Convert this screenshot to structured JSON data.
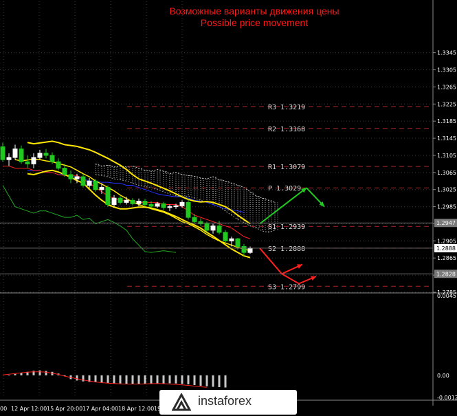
{
  "title_ru": "Возможные варианты движения цены",
  "title_en": "Possible price movement",
  "watermark": "instaforex",
  "colors": {
    "bg": "#000000",
    "grid": "#3a3a3a",
    "axis_text": "#ffffff",
    "level_line": "#b22222",
    "level_text": "#d8d8d8",
    "bull": "#ffffff",
    "bear": "#20c820",
    "bollinger": "#ffe600",
    "kijun": "#ff2020",
    "tenkan": "#2030ff",
    "chikou": "#22aa22",
    "arrow_up": "#22cc22",
    "arrow_down": "#ff2020",
    "title": "#ff1a1a",
    "macd_hist": "#c8c8c8",
    "signal": "#ff2020",
    "badge_bg": "#7a7a7a"
  },
  "chart_data": {
    "type": "candlestick",
    "ylim": [
      1.2785,
      1.3465
    ],
    "y_ticks": [
      "1.3345",
      "1.3305",
      "1.3265",
      "1.3225",
      "1.3185",
      "1.3145",
      "1.3105",
      "1.3065",
      "1.3025",
      "1.2985",
      "1.2945",
      "1.2905",
      "1.2865",
      "1.2825",
      "1.2785"
    ],
    "x_ticks": [
      "00",
      "12 Apr 12:00",
      "15 Apr 20:00",
      "17 Apr 04:00",
      "18 Apr 12:00",
      "19 Ap"
    ],
    "levels": [
      {
        "label": "R3",
        "value": "1.3219"
      },
      {
        "label": "R2",
        "value": "1.3168"
      },
      {
        "label": "R1",
        "value": "1.3079"
      },
      {
        "label": "P",
        "value": "1.3029"
      },
      {
        "label": "S1",
        "value": "1.2939"
      },
      {
        "label": "S2",
        "value": "1.2888"
      },
      {
        "label": "S3",
        "value": "1.2799"
      }
    ],
    "price_badges": [
      {
        "value": "1.2947",
        "highlight": true
      },
      {
        "value": "1.2888",
        "highlight": false
      },
      {
        "value": "1.2828",
        "highlight": true
      }
    ],
    "candles": [
      [
        1.3125,
        1.3135,
        1.309,
        1.3095
      ],
      [
        1.3095,
        1.311,
        1.308,
        1.31
      ],
      [
        1.31,
        1.313,
        1.3095,
        1.312
      ],
      [
        1.312,
        1.3128,
        1.3085,
        1.309
      ],
      [
        1.309,
        1.3105,
        1.3075,
        1.3085
      ],
      [
        1.3085,
        1.311,
        1.3075,
        1.31
      ],
      [
        1.31,
        1.3118,
        1.3095,
        1.311
      ],
      [
        1.311,
        1.312,
        1.3098,
        1.3105
      ],
      [
        1.3105,
        1.3112,
        1.3085,
        1.309
      ],
      [
        1.309,
        1.3098,
        1.307,
        1.3075
      ],
      [
        1.3075,
        1.3085,
        1.3055,
        1.306
      ],
      [
        1.306,
        1.307,
        1.304,
        1.305
      ],
      [
        1.305,
        1.3062,
        1.304,
        1.3055
      ],
      [
        1.3055,
        1.3062,
        1.303,
        1.3035
      ],
      [
        1.3035,
        1.3052,
        1.3028,
        1.3045
      ],
      [
        1.3045,
        1.305,
        1.302,
        1.3025
      ],
      [
        1.3025,
        1.304,
        1.3015,
        1.303
      ],
      [
        1.303,
        1.3035,
        1.2985,
        1.299
      ],
      [
        1.299,
        1.3012,
        1.2984,
        1.3005
      ],
      [
        1.3005,
        1.301,
        1.299,
        1.2995
      ],
      [
        1.2995,
        1.3008,
        1.299,
        1.3
      ],
      [
        1.3,
        1.3005,
        1.2988,
        1.2992
      ],
      [
        1.2992,
        1.3004,
        1.2986,
        1.2998
      ],
      [
        1.2998,
        1.3003,
        1.2985,
        1.299
      ],
      [
        1.299,
        1.2998,
        1.2982,
        1.2986
      ],
      [
        1.2986,
        1.2996,
        1.2982,
        1.2992
      ],
      [
        1.2992,
        1.2996,
        1.2978,
        1.2983
      ],
      [
        1.2983,
        1.299,
        1.2975,
        1.2985
      ],
      [
        1.2985,
        1.2992,
        1.298,
        1.2987
      ],
      [
        1.2987,
        1.3,
        1.2983,
        1.2995
      ],
      [
        1.2995,
        1.3002,
        1.2955,
        1.296
      ],
      [
        1.296,
        1.2968,
        1.2945,
        1.295
      ],
      [
        1.295,
        1.2958,
        1.294,
        1.2945
      ],
      [
        1.2945,
        1.295,
        1.2925,
        1.293
      ],
      [
        1.293,
        1.2945,
        1.2922,
        1.294
      ],
      [
        1.294,
        1.2952,
        1.292,
        1.2925
      ],
      [
        1.2925,
        1.293,
        1.29,
        1.2905
      ],
      [
        1.2905,
        1.2915,
        1.2892,
        1.291
      ],
      [
        1.291,
        1.2912,
        1.2885,
        1.2892
      ],
      [
        1.2892,
        1.2898,
        1.287,
        1.2878
      ],
      [
        1.2878,
        1.2892,
        1.2875,
        1.2888
      ]
    ],
    "bollinger_upper": [
      1.3135,
      1.3132,
      1.3134,
      1.3136,
      1.3138,
      1.3135,
      1.313,
      1.3128,
      1.3126,
      1.3122,
      1.3118,
      1.3112,
      1.3105,
      1.3098,
      1.309,
      1.3082,
      1.3072,
      1.306,
      1.305,
      1.3045,
      1.304,
      1.3034,
      1.3028,
      1.3022,
      1.3015,
      1.3008,
      1.3002,
      1.2998,
      1.2996,
      1.2997,
      1.2995,
      1.299,
      1.2985,
      1.2976,
      1.2965,
      1.2955,
      1.2945
    ],
    "bollinger_middle": [
      1.3095,
      1.3092,
      1.3094,
      1.3096,
      1.3095,
      1.3092,
      1.309,
      1.3086,
      1.3082,
      1.3078,
      1.307,
      1.3062,
      1.3055,
      1.3045,
      1.3038,
      1.303,
      1.3022,
      1.3012,
      1.3004,
      1.2996,
      1.299,
      1.2985,
      1.298,
      1.2976,
      1.2972,
      1.2966,
      1.2958,
      1.295,
      1.2945,
      1.2938,
      1.293,
      1.292,
      1.2912,
      1.2905,
      1.29,
      1.2895,
      1.289,
      1.2886,
      1.2882
    ],
    "bollinger_lower": [
      1.3062,
      1.306,
      1.3064,
      1.3068,
      1.307,
      1.3066,
      1.306,
      1.3054,
      1.3046,
      1.304,
      1.3026,
      1.3012,
      1.3,
      1.299,
      1.2984,
      1.298,
      1.298,
      1.2982,
      1.2984,
      1.2984,
      1.2982,
      1.2978,
      1.2974,
      1.2968,
      1.2962,
      1.2955,
      1.2948,
      1.2942,
      1.2935,
      1.2925,
      1.2916,
      1.2906,
      1.2896,
      1.2886,
      1.2878,
      1.287,
      1.2866
    ],
    "kijun": [
      1.308,
      1.308,
      1.3075,
      1.3075,
      1.3075,
      1.307,
      1.307,
      1.3065,
      1.3065,
      1.306,
      1.3058,
      1.3058,
      1.3058,
      1.305,
      1.304,
      1.303,
      1.302,
      1.301,
      1.3005,
      1.3,
      1.3,
      1.2998,
      1.2995,
      1.2995,
      1.2995,
      1.2995,
      1.299,
      1.299,
      1.299,
      1.2985,
      1.2975,
      1.2965,
      1.296,
      1.2955,
      1.295,
      1.2945,
      1.294,
      1.2935,
      1.2925,
      1.2915,
      1.291
    ],
    "tenkan": [
      1.307,
      1.307,
      1.307,
      1.3065,
      1.3065,
      1.306,
      1.306,
      1.3055,
      1.3055,
      1.305,
      1.3045,
      1.3045,
      1.3042,
      1.3042,
      1.304,
      1.304,
      1.3035,
      1.3035,
      1.303,
      1.3025,
      1.302,
      1.3015,
      1.3012,
      1.301,
      1.3008,
      1.3008,
      1.3005,
      1.3,
      1.2998,
      1.2995,
      1.299,
      1.2985,
      1.298,
      1.2978,
      1.2975,
      1.2972
    ],
    "chikou": [
      1.3035,
      1.301,
      1.2985,
      1.298,
      1.2975,
      1.297,
      1.2975,
      1.2975,
      1.297,
      1.2965,
      1.296,
      1.296,
      1.2965,
      1.2955,
      1.2958,
      1.2945,
      1.295,
      1.2955,
      1.2948,
      1.294,
      1.293,
      1.291,
      1.2895,
      1.288,
      1.2878,
      1.288,
      1.2882,
      1.288,
      1.2878
    ],
    "cloud_upper": [
      1.3085,
      1.308,
      1.3082,
      1.3078,
      1.308,
      1.3078,
      1.308,
      1.3075,
      1.307,
      1.3068,
      1.3072,
      1.3068,
      1.3062,
      1.3065,
      1.306,
      1.3058,
      1.3056,
      1.3052,
      1.305,
      1.3055,
      1.3048,
      1.3045,
      1.304,
      1.3035,
      1.303,
      1.302,
      1.301,
      1.3005,
      1.3,
      1.2995
    ],
    "cloud_lower": [
      1.306,
      1.3058,
      1.3055,
      1.305,
      1.3048,
      1.3045,
      1.304,
      1.3035,
      1.3032,
      1.303,
      1.3025,
      1.302,
      1.3015,
      1.301,
      1.3008,
      1.301,
      1.3005,
      1.3,
      1.2995,
      1.299,
      1.2985,
      1.2975,
      1.2965,
      1.2955,
      1.2948,
      1.294,
      1.2935,
      1.2928,
      1.2925,
      1.293
    ],
    "macd": {
      "ylim": [
        -0.00127,
        0.00457
      ],
      "y_ticks": [
        "0.00457",
        "0.00",
        "-0.00127"
      ],
      "histogram": [
        0.0,
        3e-05,
        8e-05,
        0.00015,
        0.0002,
        0.00026,
        0.00028,
        0.00025,
        0.0002,
        0.0001,
        -5e-05,
        -0.00022,
        -0.0003,
        -0.00035,
        -0.00038,
        -0.0004,
        -0.00042,
        -0.00044,
        -0.00046,
        -0.00047,
        -0.00048,
        -0.00049,
        -0.0005,
        -0.0005,
        -0.00049,
        -0.00048,
        -0.00047,
        -0.00046,
        -0.00047,
        -0.00049,
        -0.00052,
        -0.00056,
        -0.0006,
        -0.00063,
        -0.00066,
        -0.00068,
        -0.0007
      ],
      "signal": [
        2e-05,
        6e-05,
        0.0001,
        0.00014,
        0.00018,
        0.0002,
        0.0002,
        0.00018,
        0.00012,
        5e-05,
        -5e-05,
        -0.00012,
        -0.0002,
        -0.00027,
        -0.00033,
        -0.00038,
        -0.00042,
        -0.00045,
        -0.00047,
        -0.00049,
        -0.0005,
        -0.0005,
        -0.0005,
        -0.00049,
        -0.00048,
        -0.00047,
        -0.00048,
        -0.0005,
        -0.00052,
        -0.00055,
        -0.00058,
        -0.00062,
        -0.00066,
        -0.00069
      ]
    }
  }
}
